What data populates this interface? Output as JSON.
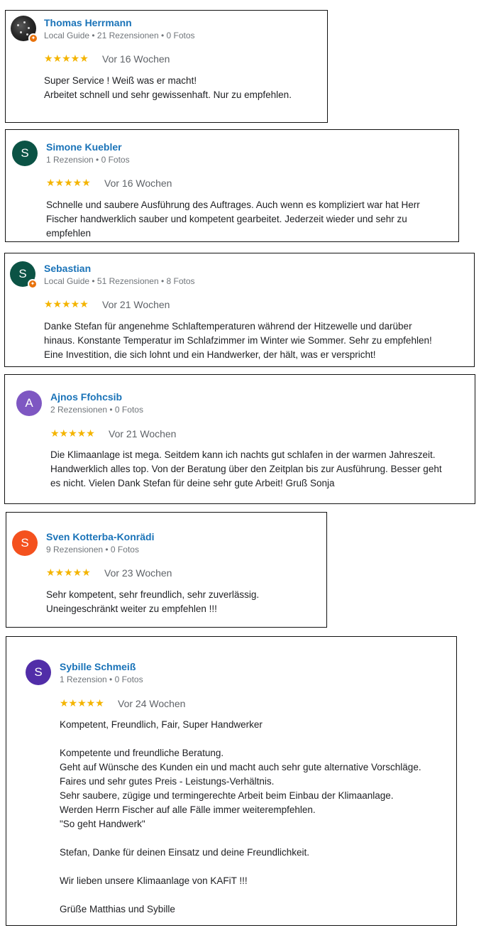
{
  "colors": {
    "link": "#1a73b8",
    "star": "#f4b400",
    "meta": "#70757a",
    "badge": "#e8710a"
  },
  "reviews": [
    {
      "name": "Thomas Herrmann",
      "meta": "Local Guide • 21 Rezensionen • 0 Fotos",
      "stars": "★★★★★",
      "date": "Vor 16 Wochen",
      "text": "Super Service ! Weiß was er macht!\nArbeitet schnell und sehr gewissenhaft. Nur zu empfehlen.",
      "avatar_letter": "",
      "avatar_color": "#2b2b2b"
    },
    {
      "name": "Simone Kuebler",
      "meta": "1 Rezension • 0 Fotos",
      "stars": "★★★★★",
      "date": "Vor 16 Wochen",
      "text": "Schnelle und saubere Ausführung des Auftrages. Auch wenn es kompliziert war hat Herr\nFischer handwerklich sauber und kompetent gearbeitet. Jederzeit wieder und sehr zu\nempfehlen",
      "avatar_letter": "S",
      "avatar_color": "#0b5345"
    },
    {
      "name": "Sebastian",
      "meta": "Local Guide • 51 Rezensionen • 8 Fotos",
      "stars": "★★★★★",
      "date": "Vor 21 Wochen",
      "text": "Danke Stefan für angenehme Schlaftemperaturen während der Hitzewelle und darüber\nhinaus. Konstante Temperatur im Schlafzimmer im Winter wie Sommer. Sehr zu empfehlen!\nEine Investition, die sich lohnt und ein Handwerker, der hält, was er verspricht!",
      "avatar_letter": "S",
      "avatar_color": "#0b5345"
    },
    {
      "name": "Ajnos Ffohcsib",
      "meta": "2 Rezensionen • 0 Fotos",
      "stars": "★★★★★",
      "date": "Vor 21 Wochen",
      "text": "Die Klimaanlage ist mega. Seitdem kann ich nachts gut schlafen in der warmen Jahreszeit.\nHandwerklich alles top. Von der Beratung über den Zeitplan bis zur Ausführung. Besser geht\nes nicht. Vielen Dank Stefan für deine sehr gute Arbeit! Gruß Sonja",
      "avatar_letter": "A",
      "avatar_color": "#7e57c2"
    },
    {
      "name": "Sven Kotterba-Konrädi",
      "meta": "9 Rezensionen • 0 Fotos",
      "stars": "★★★★★",
      "date": "Vor 23 Wochen",
      "text": "Sehr kompetent, sehr freundlich, sehr zuverlässig.\nUneingeschränkt weiter zu empfehlen !!!",
      "avatar_letter": "S",
      "avatar_color": "#f4511e"
    },
    {
      "name": "Sybille Schmeiß",
      "meta": "1 Rezension • 0 Fotos",
      "stars": "★★★★★",
      "date": "Vor 24 Wochen",
      "text": "Kompetent, Freundlich, Fair, Super Handwerker\n\nKompetente und freundliche Beratung.\nGeht auf Wünsche des Kunden ein und macht auch sehr gute alternative Vorschläge.\nFaires und sehr gutes Preis - Leistungs-Verhältnis.\nSehr saubere, zügige und termingerechte Arbeit beim Einbau der Klimaanlage.\nWerden Herrn Fischer auf alle Fälle immer weiterempfehlen.\n\"So geht Handwerk\"\n\nStefan, Danke für deinen Einsatz und deine Freundlichkeit.\n\nWir lieben unsere Klimaanlage von KAFiT !!!\n\nGrüße Matthias und Sybille",
      "avatar_letter": "S",
      "avatar_color": "#512da8"
    }
  ]
}
